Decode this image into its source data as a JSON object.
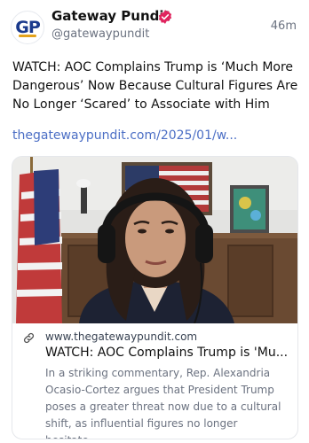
{
  "author": {
    "name": "Gateway Pundit",
    "handle": "@gatewaypundit",
    "avatar_text": "GP",
    "time": "46m"
  },
  "post": {
    "text": "WATCH: AOC Complains Trump is ‘Much More Dangerous’ Now Because Cultural Figures Are No Longer ‘Scared’ to Associate with Him",
    "link": "thegatewaypundit.com/2025/01/w..."
  },
  "card": {
    "domain": "www.thegatewaypundit.com",
    "title": "WATCH: AOC Complains Trump is 'Mu...",
    "description": "In a striking commentary, Rep. Alexandria Ocasio-Cortez argues that President Trump poses a greater threat now due to a cultural shift, as influential figures no longer hesitate..."
  },
  "colors": {
    "brand_blue": "#1a3a8c",
    "brand_gold": "#e3a21a",
    "verified": "#e0245e",
    "link": "#4c6fc5",
    "muted": "#6b7280"
  },
  "icons": {
    "verified": "verified-badge-icon",
    "link": "link-icon"
  }
}
